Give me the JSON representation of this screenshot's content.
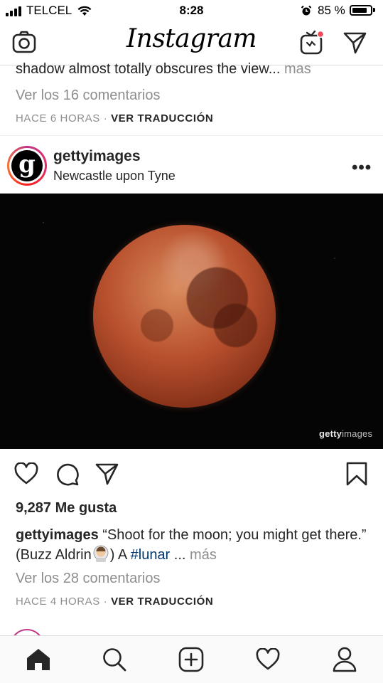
{
  "status_bar": {
    "carrier": "TELCEL",
    "time": "8:28",
    "battery_percent": "85 %",
    "battery_level": 0.85
  },
  "header": {
    "logo": "Instagram",
    "icons": [
      "camera-icon",
      "igtv-icon",
      "direct-message-icon"
    ]
  },
  "previous_post": {
    "caption_tail": "shadow almost totally obscures the view...",
    "more_label": "mas",
    "comments_label": "Ver los 16 comentarios",
    "time_ago": "HACE 6 HORAS",
    "separator": "·",
    "translate_label": "VER TRADUCCIÓN"
  },
  "post": {
    "avatar_letter": "g",
    "username": "gettyimages",
    "location": "Newcastle upon Tyne",
    "more_icon": "more-options-icon",
    "watermark_a": "getty",
    "watermark_b": "images",
    "likes": "9,287 Me gusta",
    "caption_user": "gettyimages",
    "caption_text": "“Shoot for the moon; you might get there.” (Buzz Aldrin",
    "caption_after_emoji": ") A ",
    "hashtag": "#lunar",
    "ellipsis": " ... ",
    "more_label": "más",
    "comments_label": "Ver los 28 comentarios",
    "time_ago": "HACE 4 HORAS",
    "separator": "·",
    "translate_label": "VER TRADUCCIÓN",
    "action_icons": [
      "heart-icon",
      "comment-icon",
      "share-icon",
      "bookmark-icon"
    ]
  },
  "bottom_nav": {
    "items": [
      "home-icon",
      "search-icon",
      "add-post-icon",
      "activity-heart-icon",
      "profile-icon"
    ]
  }
}
